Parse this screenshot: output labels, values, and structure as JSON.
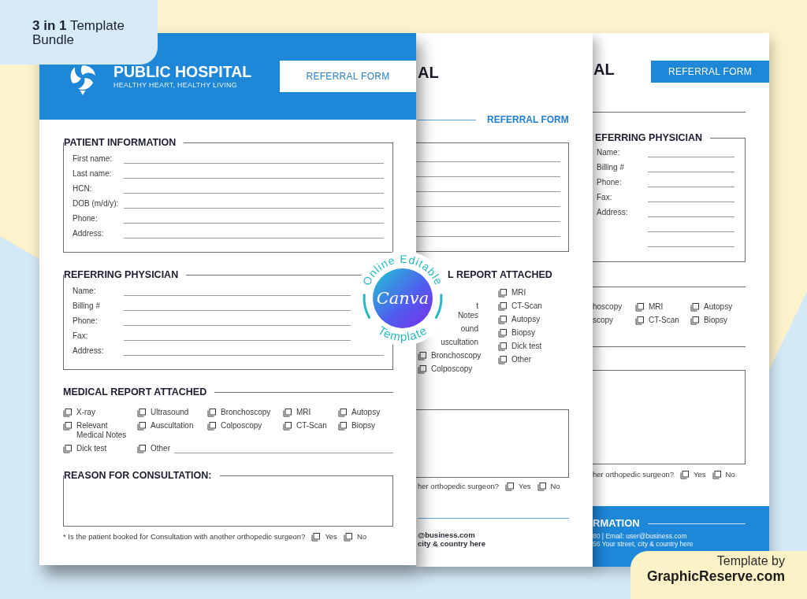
{
  "promo": {
    "bundle_label": "**3 in 1** Template Bundle"
  },
  "front_form": {
    "hospital_name": "PUBLIC HOSPITAL",
    "tagline": "HEALTHY HEART, HEALTHY LIVING",
    "form_title": "REFERRAL FORM",
    "sections": [
      {
        "kind": "fields",
        "title": "PATIENT INFORMATION",
        "fields": [
          "First name:",
          "Last name:",
          "HCN:",
          "DOB (m/d/y):",
          "Phone:",
          "Address:"
        ]
      },
      {
        "kind": "fields",
        "title": "REFERRING PHYSICIAN",
        "fields": [
          "Name:",
          "Billing #",
          "Phone:",
          "Fax:",
          "Address:"
        ]
      },
      {
        "kind": "checklist",
        "title": "MEDICAL REPORT ATTACHED",
        "items": [
          {
            "label": "X-ray",
            "checked": false,
            "kind": "plain"
          },
          {
            "label": "Ultrasound",
            "checked": false,
            "kind": "plain"
          },
          {
            "label": "Bronchoscopy",
            "checked": false,
            "kind": "plain"
          },
          {
            "label": "MRI",
            "checked": false,
            "kind": "plain"
          },
          {
            "label": "Autopsy",
            "checked": false,
            "kind": "plain"
          },
          {
            "label": "Relevant Medical Notes",
            "checked": false,
            "kind": "plain"
          },
          {
            "label": "Auscultation",
            "checked": false,
            "kind": "plain"
          },
          {
            "label": "Colposcopy",
            "checked": false,
            "kind": "plain"
          },
          {
            "label": "CT-Scan",
            "checked": false,
            "kind": "plain"
          },
          {
            "label": "Biopsy",
            "checked": false,
            "kind": "plain"
          },
          {
            "label": "Dick test",
            "checked": false,
            "kind": "plain"
          },
          {
            "label": "Other",
            "checked": false,
            "kind": "with_line"
          }
        ]
      },
      {
        "kind": "textbox",
        "title": "REASON FOR CONSULTATION:"
      }
    ],
    "question": {
      "text": "* Is the patient booked for Consultation with another orthopedic surgeon?",
      "options": [
        {
          "label": "Yes",
          "checked": false
        },
        {
          "label": "No",
          "checked": false
        }
      ]
    }
  },
  "canva_badge": {
    "top_text": "Online Editable",
    "logo_text": "Canva",
    "bottom_text": "Template"
  },
  "middle_form": {
    "title_fragment": "AL",
    "form_title": "REFERRAL FORM",
    "checklist": {
      "title_fragment": "L REPORT ATTACHED",
      "fragments": [
        [
          "t",
          "Notes"
        ],
        [
          "ound"
        ],
        [
          "uscultation"
        ]
      ],
      "left_items": [
        {
          "label": "Bronchoscopy",
          "checked": false
        },
        {
          "label": "Colposcopy",
          "checked": false
        }
      ],
      "right_items": [
        {
          "label": "MRI",
          "checked": false
        },
        {
          "label": "CT-Scan",
          "checked": false
        },
        {
          "label": "Autopsy",
          "checked": false
        },
        {
          "label": "Biopsy",
          "checked": false
        },
        {
          "label": "Dick test",
          "checked": false
        },
        {
          "label": "Other",
          "checked": false
        }
      ]
    },
    "question": {
      "text_fragment": "her orthopedic surgeon?",
      "options": [
        {
          "label": "Yes",
          "checked": false
        },
        {
          "label": "No",
          "checked": false
        }
      ]
    },
    "contact_fragments": [
      "@business.com",
      "city & country here"
    ]
  },
  "back_form": {
    "title_fragment": "AL",
    "form_title": "REFERRAL FORM",
    "physician": {
      "title_fragment": "EFERRING PHYSICIAN",
      "fields": [
        "Name:",
        "Billing #",
        "Phone:",
        "Fax:",
        "Address:"
      ]
    },
    "checklist": {
      "fragments": [
        "hoscopy",
        "scopy"
      ],
      "items": [
        {
          "label": "MRI",
          "checked": false
        },
        {
          "label": "Autopsy",
          "checked": false
        },
        {
          "label": "CT-Scan",
          "checked": false
        },
        {
          "label": "Biopsy",
          "checked": false
        }
      ]
    },
    "question": {
      "text_fragment": "her orthopedic surgeon?",
      "options": [
        {
          "label": "Yes",
          "checked": false
        },
        {
          "label": "No",
          "checked": false
        }
      ]
    },
    "footer": {
      "title_fragment": "RMATION",
      "lines": [
        "80 | Email: user@business.com",
        "56 Your street, city & country here"
      ]
    }
  },
  "credit": {
    "caption": "Template by",
    "site": "GraphicReserve.com"
  }
}
